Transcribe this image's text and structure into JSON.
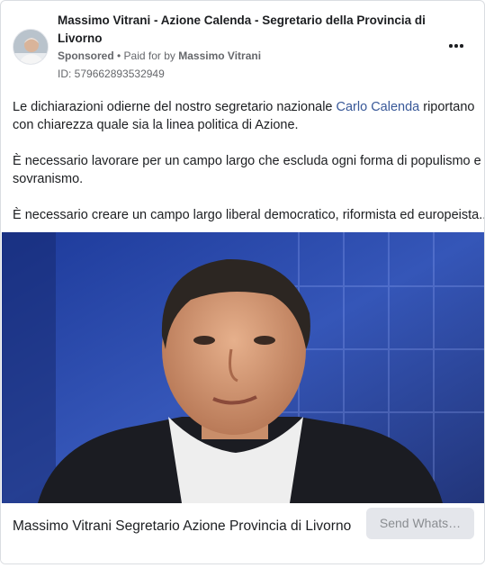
{
  "post": {
    "author_line1": "Massimo Vitrani - Azione Calenda - Segretario della Provincia di",
    "author_line2": "Livorno",
    "sponsored": "Sponsored",
    "paid_for_prefix": " • Paid for by ",
    "paid_for_name": "Massimo Vitrani",
    "ad_id": "ID: 579662893532949",
    "more_icon": "more-horizontal-icon"
  },
  "body": {
    "p1_start": "Le dichiarazioni odierne del nostro segretario nazionale ",
    "p1_link": "Carlo Calenda",
    "p1_end": " riportano",
    "p1_line2": "con chiarezza quale sia la linea politica di Azione.",
    "p2_line1": "È necessario lavorare per un campo largo che escluda ogni forma di populismo e",
    "p2_line2": "sovranismo.",
    "p3": "È necessario creare un campo largo liberal democratico, riformista ed europeista...."
  },
  "footer": {
    "title": "Massimo Vitrani Segretario Azione Provincia di Livorno",
    "cta": "Send Whats…"
  },
  "colors": {
    "link": "#385898",
    "muted": "#65676b",
    "cta_bg": "#e4e6eb",
    "media_bg": "#2a3e8c"
  }
}
